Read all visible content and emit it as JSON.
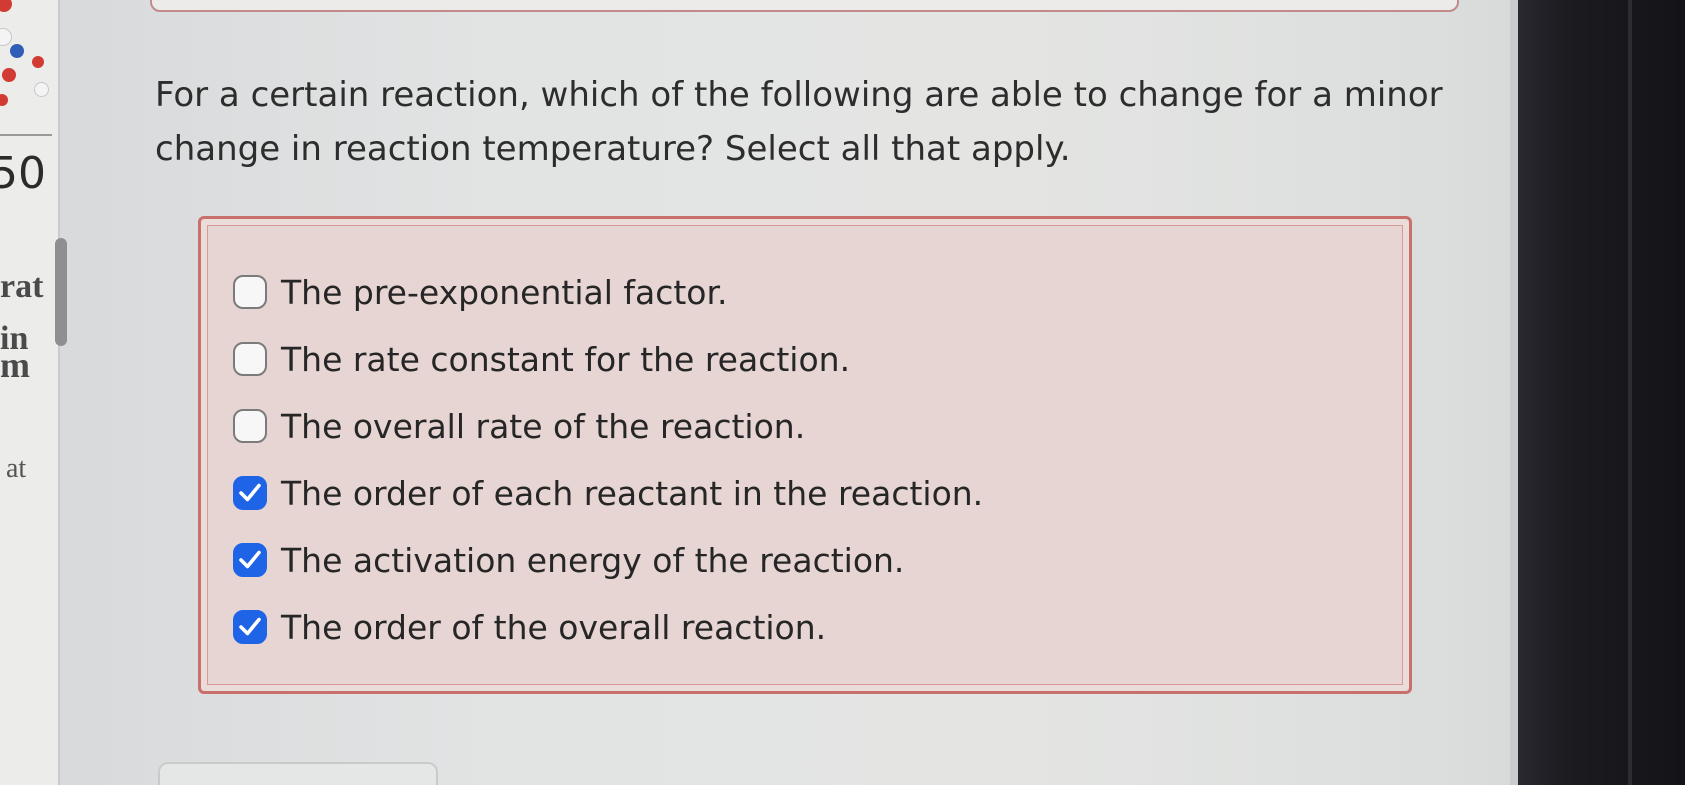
{
  "left_panel": {
    "number_fragment": "50",
    "text_fragments": [
      "rat",
      "in",
      "m",
      "at"
    ]
  },
  "question": {
    "text": "For a certain reaction, which of the following are able to change for a minor change in reaction temperature? Select all that apply."
  },
  "options": [
    {
      "label": "The pre-exponential factor.",
      "checked": false
    },
    {
      "label": "The rate constant for the reaction.",
      "checked": false
    },
    {
      "label": "The overall rate of the reaction.",
      "checked": false
    },
    {
      "label": "The order of each reactant in the reaction.",
      "checked": true
    },
    {
      "label": "The activation energy of the reaction.",
      "checked": true
    },
    {
      "label": "The order of the overall reaction.",
      "checked": true
    }
  ],
  "colors": {
    "checked_box": "#1f63e6",
    "answer_border": "#c96f6c",
    "answer_background": "#e6d5d2"
  }
}
